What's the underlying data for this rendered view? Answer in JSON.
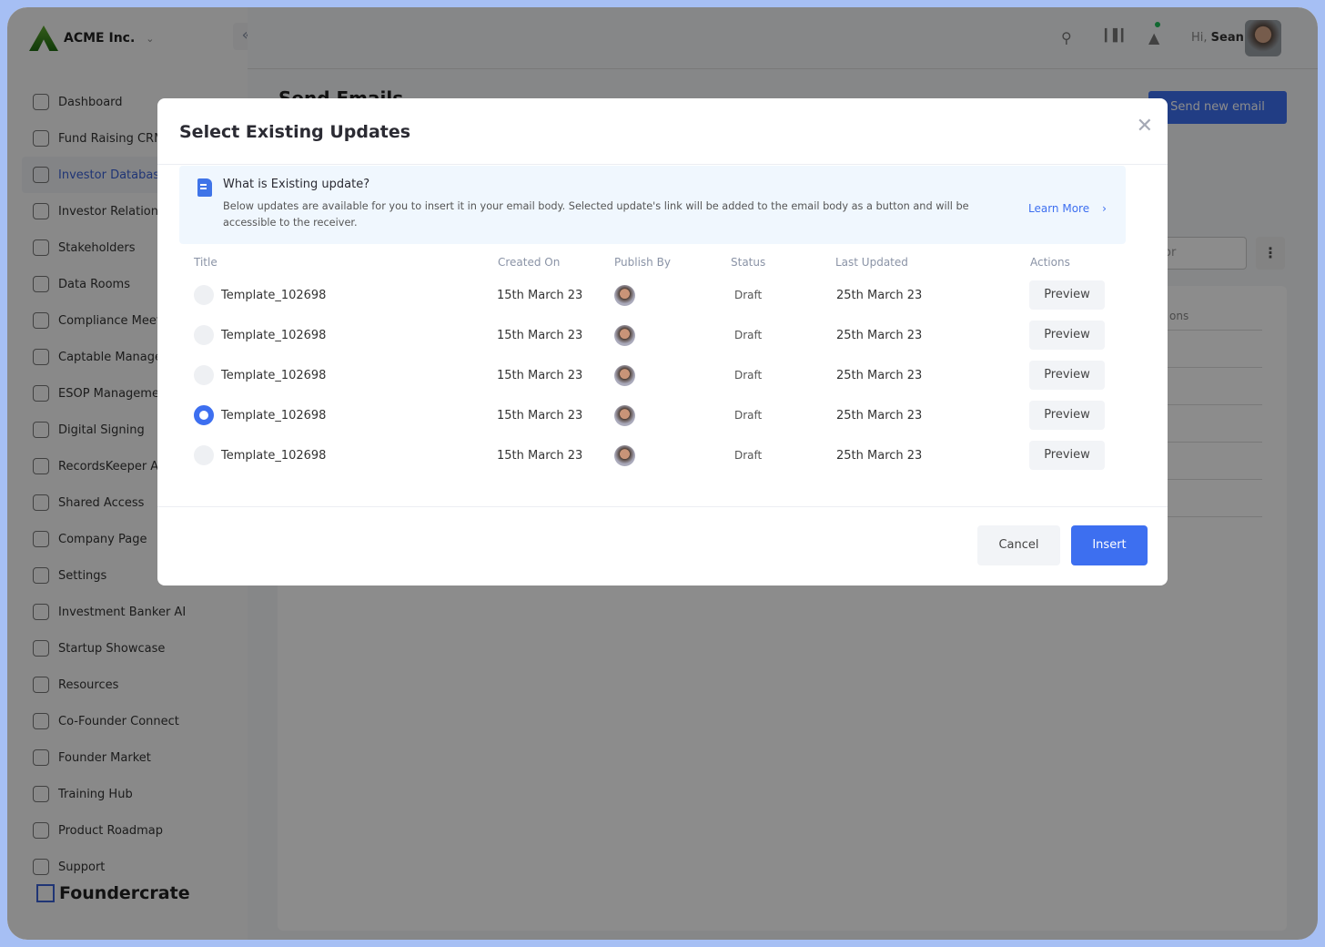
{
  "company": "ACME Inc.",
  "sidebar": {
    "items": [
      {
        "label": "Dashboard"
      },
      {
        "label": "Fund Raising CRM"
      },
      {
        "label": "Investor Database",
        "active": true
      },
      {
        "label": "Investor Relations"
      },
      {
        "label": "Stakeholders"
      },
      {
        "label": "Data Rooms"
      },
      {
        "label": "Compliance Meetings"
      },
      {
        "label": "Captable Management"
      },
      {
        "label": "ESOP Management"
      },
      {
        "label": "Digital Signing"
      },
      {
        "label": "RecordsKeeper AI"
      },
      {
        "label": "Shared Access"
      },
      {
        "label": "Company Page"
      },
      {
        "label": "Settings"
      },
      {
        "label": "Investment Banker AI"
      },
      {
        "label": "Startup Showcase"
      },
      {
        "label": "Resources"
      },
      {
        "label": "Co-Founder Connect"
      },
      {
        "label": "Founder Market"
      },
      {
        "label": "Training Hub"
      },
      {
        "label": "Product Roadmap"
      },
      {
        "label": "Support"
      }
    ],
    "footer_logo": "Foundercrate"
  },
  "header": {
    "greeting": "Hi,",
    "user": "Sean"
  },
  "page": {
    "title": "Send Emails",
    "send_button": "Send new email",
    "search_fragment": "or",
    "table_header_fragment": "ons"
  },
  "modal": {
    "title": "Select Existing Updates",
    "info_heading": "What is Existing update?",
    "info_text": "Below updates are available for you to insert it in your email body. Selected update's link will be added to the email body as a button and will be accessible to the receiver.",
    "learn_more": "Learn More",
    "columns": [
      "Title",
      "Created On",
      "Publish By",
      "Status",
      "Last Updated",
      "Actions"
    ],
    "rows": [
      {
        "title": "Template_102698",
        "created": "15th March 23",
        "status": "Draft",
        "updated": "25th March 23",
        "action": "Preview",
        "selected": false
      },
      {
        "title": "Template_102698",
        "created": "15th March 23",
        "status": "Draft",
        "updated": "25th March 23",
        "action": "Preview",
        "selected": false
      },
      {
        "title": "Template_102698",
        "created": "15th March 23",
        "status": "Draft",
        "updated": "25th March 23",
        "action": "Preview",
        "selected": false
      },
      {
        "title": "Template_102698",
        "created": "15th March 23",
        "status": "Draft",
        "updated": "25th March 23",
        "action": "Preview",
        "selected": true
      },
      {
        "title": "Template_102698",
        "created": "15th March 23",
        "status": "Draft",
        "updated": "25th March 23",
        "action": "Preview",
        "selected": false
      }
    ],
    "cancel": "Cancel",
    "insert": "Insert"
  },
  "colors": {
    "accent": "#3d6ff0",
    "frame": "#a6bff4"
  }
}
